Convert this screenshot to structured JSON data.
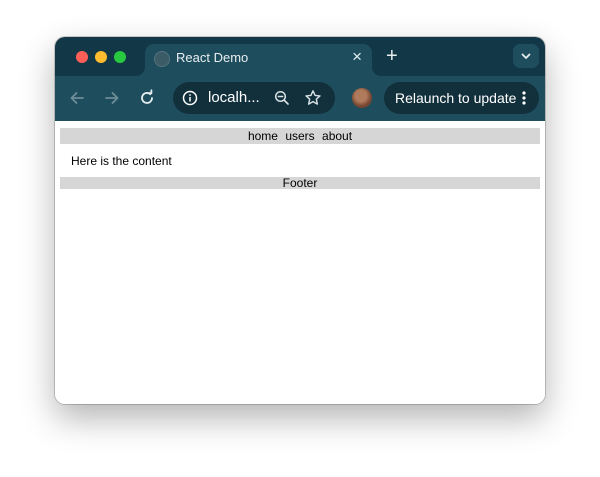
{
  "browser": {
    "tab": {
      "title": "React Demo",
      "close_symbol": "×"
    },
    "new_tab_symbol": "+",
    "omnibox": {
      "url": "localh..."
    },
    "relaunch_label": "Relaunch to update",
    "icons": [
      "back-icon",
      "forward-icon",
      "reload-icon",
      "info-icon",
      "zoom-out-icon",
      "bookmark-star-icon",
      "profile-avatar",
      "more-menu-icon",
      "tab-search-chevron-icon"
    ],
    "colors": {
      "tabstrip": "#123847",
      "toolbar": "#1e4e5e",
      "omnibox": "#12303c"
    }
  },
  "page": {
    "nav": [
      "home",
      "users",
      "about"
    ],
    "content": "Here is the content",
    "footer": "Footer",
    "colors": {
      "bars": "#d6d6d6"
    }
  }
}
